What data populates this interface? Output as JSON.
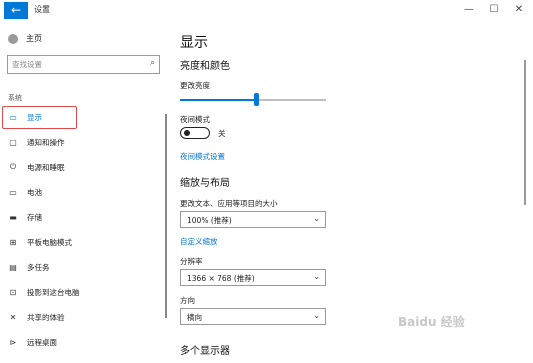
{
  "window": {
    "back_glyph": "←",
    "title": "设置",
    "minimize_glyph": "—",
    "maximize_glyph": "☐",
    "close_glyph": "✕",
    "accent_color": "#0078d7"
  },
  "sidebar": {
    "home_label": "主页",
    "search_placeholder": "查找设置",
    "search_icon": "search-icon",
    "section_label": "系统",
    "items": [
      {
        "label": "显示",
        "icon": "monitor-icon",
        "glyph": "▭",
        "active": true
      },
      {
        "label": "通知和操作",
        "icon": "chat-icon",
        "glyph": "▢"
      },
      {
        "label": "电源和睡眠",
        "icon": "power-icon",
        "glyph": "⏻"
      },
      {
        "label": "电池",
        "icon": "battery-icon",
        "glyph": "▭"
      },
      {
        "label": "存储",
        "icon": "storage-icon",
        "glyph": "▬"
      },
      {
        "label": "平板电脑模式",
        "icon": "tablet-icon",
        "glyph": "⊞"
      },
      {
        "label": "多任务",
        "icon": "multitask-icon",
        "glyph": "▤"
      },
      {
        "label": "投影到这台电脑",
        "icon": "projector-icon",
        "glyph": "⊡"
      },
      {
        "label": "共享的体验",
        "icon": "share-icon",
        "glyph": "✕"
      },
      {
        "label": "远程桌面",
        "icon": "remote-icon",
        "glyph": "⊳"
      }
    ]
  },
  "main": {
    "page_title": "显示",
    "brightness_section": "亮度和颜色",
    "brightness_label": "更改亮度",
    "brightness_level": 0.52,
    "night_light_label": "夜间模式",
    "night_light_state": "关",
    "night_light_settings_link": "夜间模式设置",
    "scale_section": "缩放与布局",
    "scale_label": "更改文本、应用等项目的大小",
    "scale_value": "100% (推荐)",
    "custom_scale_link": "自定义缩放",
    "resolution_label": "分辨率",
    "resolution_value": "1366 × 768 (推荐)",
    "orientation_label": "方向",
    "orientation_value": "横向",
    "multi_display_section": "多个显示器"
  },
  "watermark": "Baidu 经验"
}
